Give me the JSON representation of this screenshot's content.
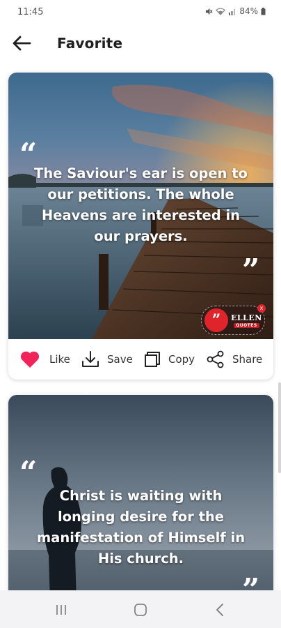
{
  "status_bar": {
    "time": "11:45",
    "battery": "84%",
    "icons": [
      "mute-icon",
      "wifi-icon",
      "signal-icon",
      "battery-icon"
    ]
  },
  "app_bar": {
    "title": "Favorite",
    "back_icon": "arrow-left-icon"
  },
  "quotes": [
    {
      "text": "The Saviour's ear is open to our petitions. The whole Heavens are interested in our prayers.",
      "open_mark": "“",
      "close_mark": "”",
      "background": "sunset-pier-photo",
      "watermark": {
        "brand": "ELLEN",
        "sub": "QUOTES",
        "mark": "”",
        "close": "x"
      },
      "actions": [
        {
          "label": "Like",
          "icon": "heart-icon",
          "liked": true
        },
        {
          "label": "Save",
          "icon": "download-icon"
        },
        {
          "label": "Copy",
          "icon": "copy-icon"
        },
        {
          "label": "Share",
          "icon": "share-icon"
        }
      ]
    },
    {
      "text": "Christ is waiting with longing desire for the manifestation of Himself in His church.",
      "open_mark": "“",
      "close_mark": "”",
      "background": "silhouette-man-dusk-photo"
    }
  ],
  "nav_bar": {
    "buttons": [
      "recents-icon",
      "home-icon",
      "back-icon"
    ]
  },
  "colors": {
    "accent": "#f0245a",
    "watermark_red": "#e0242c",
    "nav_bg": "#f3f3f5"
  }
}
